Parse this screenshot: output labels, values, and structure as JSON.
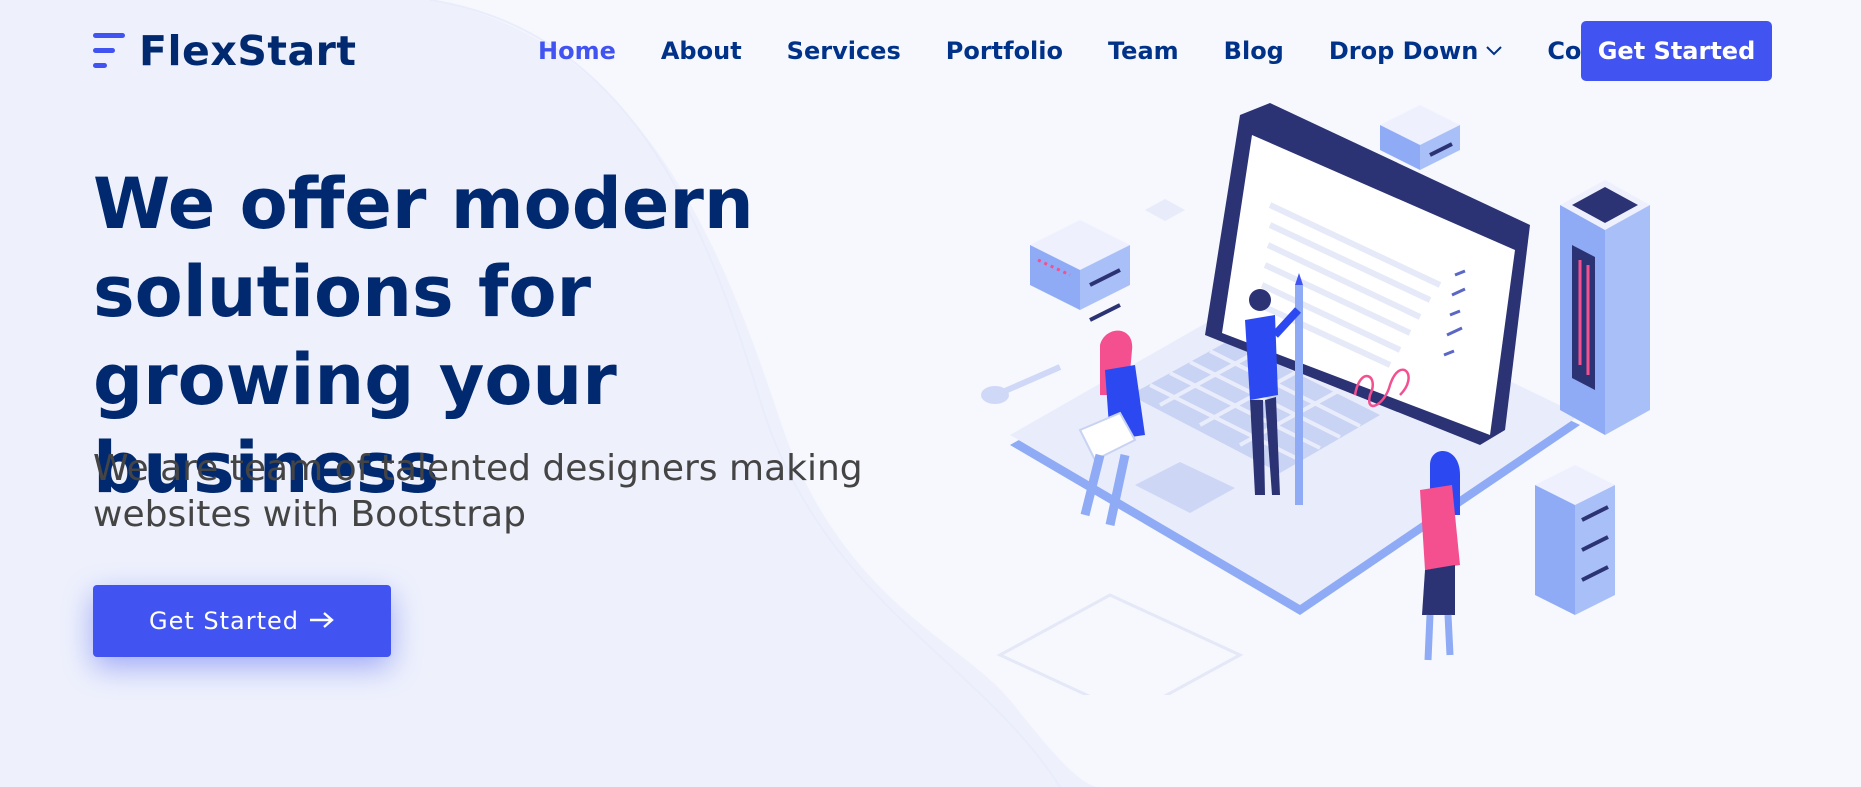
{
  "brand": {
    "name": "FlexStart",
    "accent": "#4154f1",
    "dark": "#012970"
  },
  "nav": {
    "items": [
      {
        "label": "Home",
        "active": true
      },
      {
        "label": "About"
      },
      {
        "label": "Services"
      },
      {
        "label": "Portfolio"
      },
      {
        "label": "Team"
      },
      {
        "label": "Blog"
      },
      {
        "label": "Drop Down",
        "icon": "chevron-down-icon"
      },
      {
        "label": "Contact"
      }
    ],
    "cta_label": "Get Started"
  },
  "hero": {
    "title": "We offer modern solutions for growing your business",
    "subtitle": "We are team of talented designers making websites with Bootstrap",
    "button_label": "Get Started",
    "button_icon": "arrow-right-icon"
  },
  "illustration": {
    "icon": "hero-illustration-icon"
  }
}
